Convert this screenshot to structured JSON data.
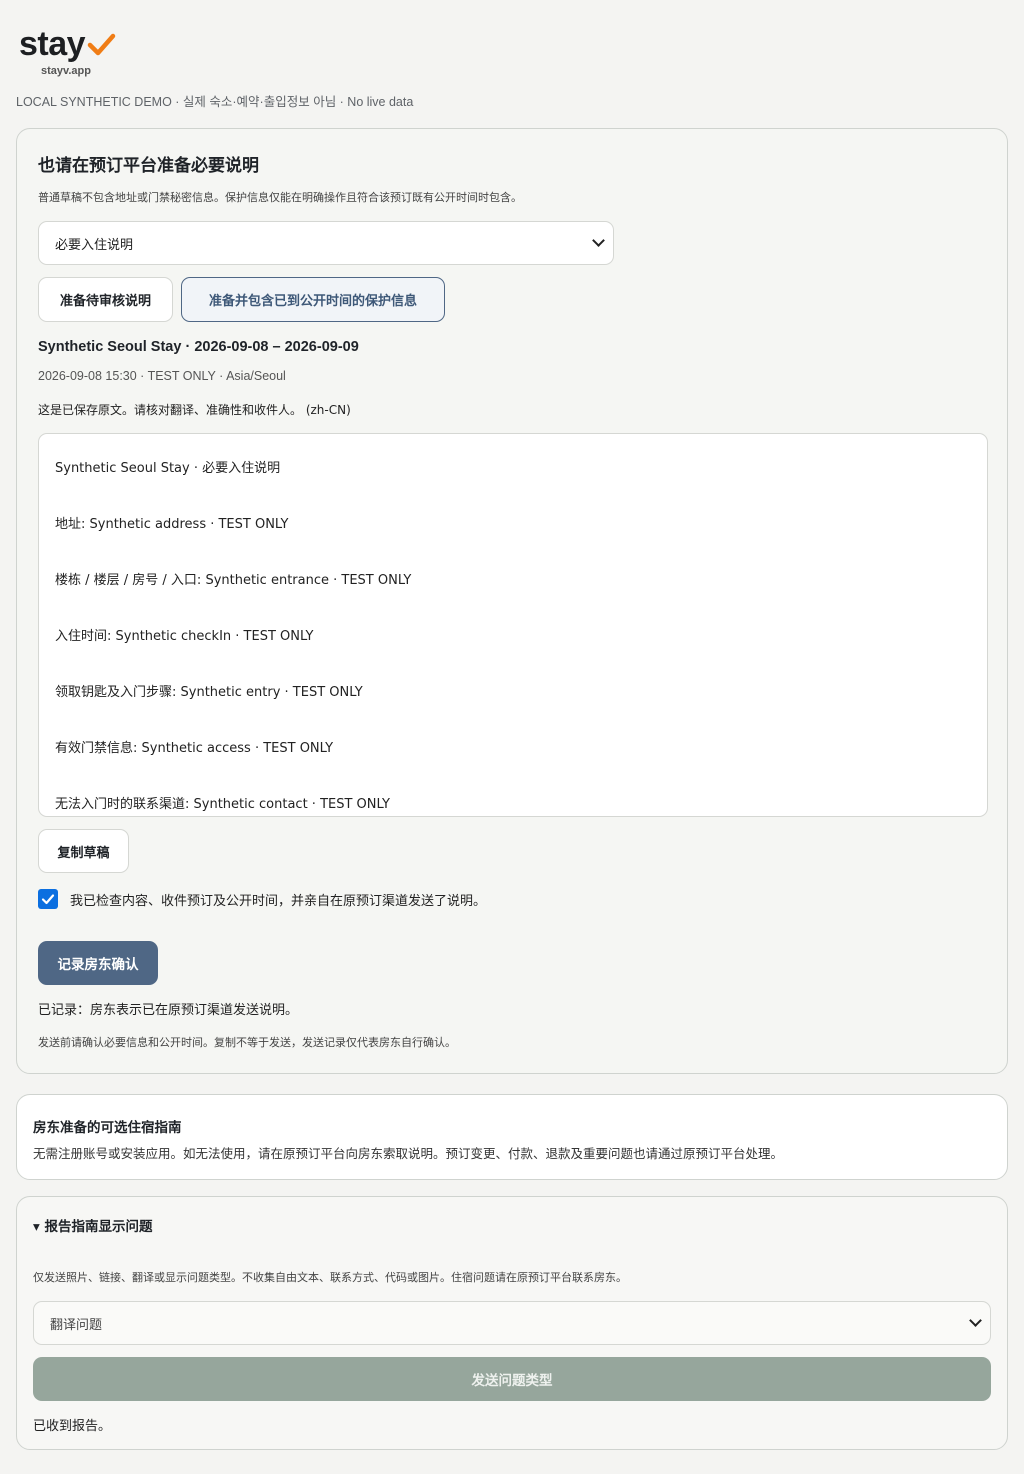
{
  "brand": {
    "logo_text": "stay",
    "domain": "stayv.app",
    "accent_color": "#f07d16"
  },
  "demo_note": "LOCAL SYNTHETIC DEMO · 실제 숙소·예약·출입정보 아님 · No live data",
  "main": {
    "title": "也请在预订平台准备必要说明",
    "sub_note": "普通草稿不包含地址或门禁秘密信息。保护信息仅能在明确操作且符合该预订既有公开时间时包含。",
    "info_select": {
      "selected": "必要入住说明"
    },
    "btn_pending": "准备待审核说明",
    "btn_protect": "准备并包含已到公开时间的保护信息",
    "stay_title": "Synthetic Seoul Stay · 2026-09-08 – 2026-09-09",
    "stay_meta": "2026-09-08 15:30 · TEST ONLY · Asia/Seoul",
    "saved_note": "这是已保存原文。请核对翻译、准确性和收件人。 (zh-CN)",
    "draft_lines": [
      "Synthetic Seoul Stay · 必要入住说明",
      "地址: Synthetic address · TEST ONLY",
      "楼栋 / 楼层 / 房号 / 入口: Synthetic entrance · TEST ONLY",
      "入住时间: Synthetic checkIn · TEST ONLY",
      "领取钥匙及入门步骤: Synthetic entry · TEST ONLY",
      "有效门禁信息: Synthetic access · TEST ONLY",
      "无法入门时的联系渠道: Synthetic contact · TEST ONLY"
    ],
    "btn_copy": "复制草稿",
    "confirm_label": "我已检查内容、收件预订及公开时间，并亲自在原预订渠道发送了说明。",
    "btn_record": "记录房东确认",
    "recorded": "已记录：房东表示已在原预订渠道发送说明。",
    "footnote": "发送前请确认必要信息和公开时间。复制不等于发送，发送记录仅代表房东自行确认。"
  },
  "guide": {
    "title": "房东准备的可选住宿指南",
    "body": "无需注册账号或安装应用。如无法使用，请在原预订平台向房东索取说明。预订变更、付款、退款及重要问题也请通过原预订平台处理。"
  },
  "report": {
    "summary": "▾ 报告指南显示问题",
    "note": "仅发送照片、链接、翻译或显示问题类型。不收集自由文本、联系方式、代码或图片。住宿问题请在原预订平台联系房东。",
    "type_select": {
      "selected": "翻译问题"
    },
    "btn_send": "发送问题类型",
    "received": "已收到报告。"
  }
}
